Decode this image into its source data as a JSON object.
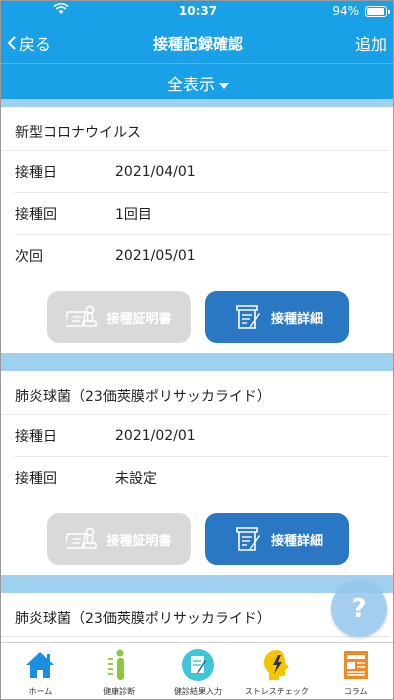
{
  "status": {
    "time": "10:37",
    "battery": "94%",
    "battery_level": 0.94
  },
  "nav": {
    "back_label": "戻る",
    "title": "接種記録確認",
    "add_label": "追加"
  },
  "filter": {
    "label": "全表示"
  },
  "records": [
    {
      "name": "新型コロナウイルス",
      "fields": [
        {
          "key": "接種日",
          "value": "2021/04/01"
        },
        {
          "key": "接種回",
          "value": "1回目"
        },
        {
          "key": "次回",
          "value": "2021/05/01"
        }
      ],
      "cert_button": "接種証明書",
      "detail_button": "接種詳細"
    },
    {
      "name": "肺炎球菌（23価莢膜ポリサッカライド）",
      "fields": [
        {
          "key": "接種日",
          "value": "2021/02/01"
        },
        {
          "key": "接種回",
          "value": "未設定"
        }
      ],
      "cert_button": "接種証明書",
      "detail_button": "接種詳細"
    },
    {
      "name": "肺炎球菌（23価莢膜ポリサッカライド）"
    }
  ],
  "help_label": "?",
  "tabs": [
    {
      "label": "ホーム",
      "icon": "home-icon"
    },
    {
      "label": "健康診断",
      "icon": "health-checkup-icon"
    },
    {
      "label": "健診結果入力",
      "icon": "checkup-input-icon"
    },
    {
      "label": "ストレスチェック",
      "icon": "stress-check-icon"
    },
    {
      "label": "コラム",
      "icon": "column-icon"
    }
  ],
  "colors": {
    "header": "#1aa0e6",
    "separator": "#9fd0ef",
    "primary_button": "#2a78c4",
    "disabled_button": "#d9d9d9"
  }
}
